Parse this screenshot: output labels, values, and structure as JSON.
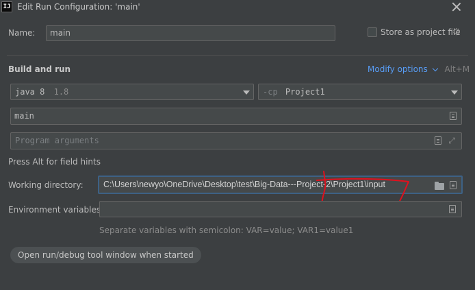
{
  "window": {
    "title": "Edit Run Configuration: 'main'",
    "app_icon_text": "IJ"
  },
  "name_field": {
    "label": "Name:",
    "value": "main"
  },
  "store": {
    "label": "Store as project file",
    "checked": false
  },
  "build": {
    "heading": "Build and run",
    "modify_options": "Modify options",
    "shortcut": "Alt+M",
    "jdk": {
      "name": "java 8",
      "version": "1.8"
    },
    "classpath": {
      "flag": "-cp",
      "module": "Project1"
    },
    "main_class": "main",
    "program_args_placeholder": "Program arguments",
    "hint": "Press Alt for field hints"
  },
  "working_dir": {
    "label": "Working directory:",
    "value": "C:\\Users\\newyo\\OneDrive\\Desktop\\test\\Big-Data---Project-2\\Project1\\input"
  },
  "env": {
    "label": "Environment variables:",
    "value": "",
    "hint": "Separate variables with semicolon: VAR=value; VAR1=value1"
  },
  "tool_window_option": "Open run/debug tool window when started",
  "annotation_color": "#e0111e",
  "icons": [
    "intellij-app-icon",
    "close-icon",
    "gear-icon",
    "chevron-down-icon",
    "document-icon",
    "folder-icon",
    "expand-icon"
  ]
}
